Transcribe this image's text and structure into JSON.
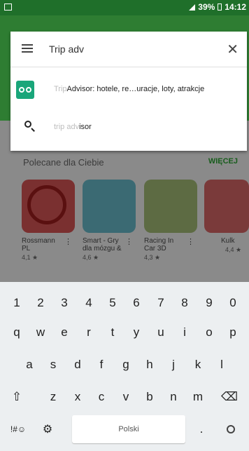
{
  "status": {
    "battery": "39%",
    "time": "14:12"
  },
  "search": {
    "query": "Trip adv",
    "suggestion1_prefix": "Trip",
    "suggestion1_rest": "Advisor: hotele, re…uracje, loty, atrakcje",
    "suggestion2_prefix": "trip adv",
    "suggestion2_rest": "isor"
  },
  "section": {
    "title": "Polecane dla Ciebie",
    "more": "WIĘCEJ"
  },
  "apps": [
    {
      "name": "Rossmann PL",
      "rating": "4,1 ★"
    },
    {
      "name": "Smart - Gry dla mózgu &",
      "rating": "4,6 ★"
    },
    {
      "name": "Racing In Car 3D",
      "rating": "4,3 ★"
    },
    {
      "name": "Kulk",
      "rating": "4,4 ★"
    }
  ],
  "keyboard": {
    "row1": [
      "1",
      "2",
      "3",
      "4",
      "5",
      "6",
      "7",
      "8",
      "9",
      "0"
    ],
    "row2": [
      "q",
      "w",
      "e",
      "r",
      "t",
      "y",
      "u",
      "i",
      "o",
      "p"
    ],
    "row3": [
      "a",
      "s",
      "d",
      "f",
      "g",
      "h",
      "j",
      "k",
      "l"
    ],
    "row4": [
      "⇧",
      "z",
      "x",
      "c",
      "v",
      "b",
      "n",
      "m",
      "⌫"
    ],
    "symbols": "!#☺",
    "space_label": "Polski",
    "period": "."
  }
}
